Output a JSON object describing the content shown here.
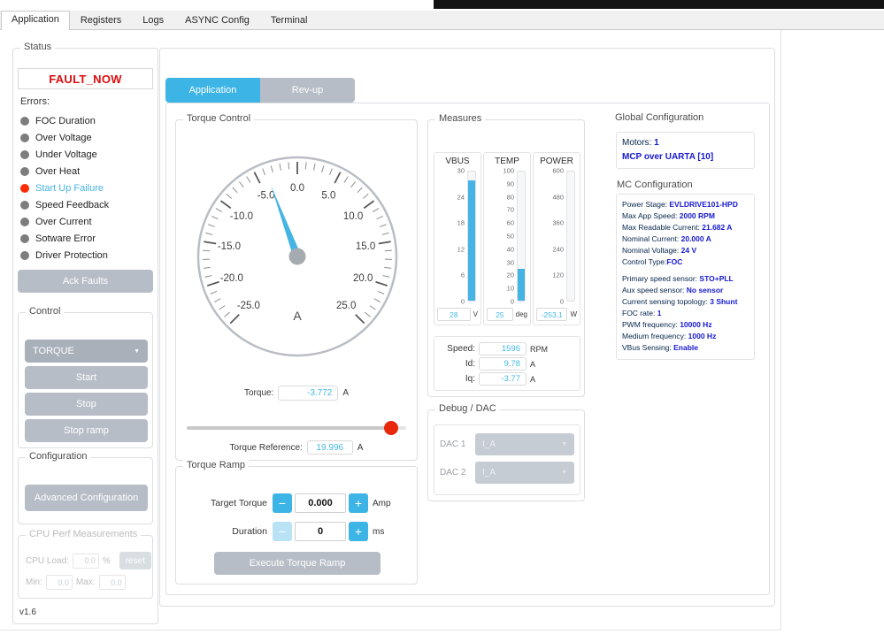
{
  "icons": {
    "chevron_down": "▼",
    "minus": "−",
    "plus": "+"
  },
  "window": {
    "tabs": [
      {
        "label": "Application",
        "active": true
      },
      {
        "label": "Registers"
      },
      {
        "label": "Logs"
      },
      {
        "label": "ASYNC Config"
      },
      {
        "label": "Terminal"
      }
    ]
  },
  "status": {
    "legend": "Status",
    "fault_banner": "FAULT_NOW",
    "errors_label": "Errors:",
    "errors": [
      {
        "label": "FOC Duration",
        "active": false
      },
      {
        "label": "Over Voltage",
        "active": false
      },
      {
        "label": "Under Voltage",
        "active": false
      },
      {
        "label": "Over Heat",
        "active": false
      },
      {
        "label": "Start Up Failure",
        "active": true
      },
      {
        "label": "Speed Feedback",
        "active": false
      },
      {
        "label": "Over Current",
        "active": false
      },
      {
        "label": "Sotware Error",
        "active": false
      },
      {
        "label": "Driver Protection",
        "active": false
      }
    ],
    "ack_button": "Ack Faults"
  },
  "control": {
    "legend": "Control",
    "mode_dropdown": "TORQUE",
    "start_button": "Start",
    "stop_button": "Stop",
    "stop_ramp_button": "Stop ramp"
  },
  "configuration": {
    "legend": "Configuration",
    "advanced_button": "Advanced Configuration"
  },
  "cpu_perf": {
    "legend": "CPU Perf Measurements",
    "load_label": "CPU Load:",
    "load_value": "0.0",
    "load_unit": "%",
    "reset_button": "reset",
    "min_label": "Min:",
    "min_value": "0.0",
    "max_label": "Max:",
    "max_value": "0.0"
  },
  "version": "v1.6",
  "main_tabs": {
    "application": "Application",
    "revup": "Rev-up"
  },
  "torque_control": {
    "legend": "Torque Control",
    "torque_label": "Torque:",
    "torque_value": "-3.772",
    "torque_unit": "A",
    "reference_label": "Torque Reference:",
    "reference_value": "19.996",
    "reference_unit": "A",
    "slider_fraction": 0.93
  },
  "torque_gauge": {
    "type": "gauge",
    "min": -25,
    "max": 25,
    "major_step": 5,
    "minor_step": 1,
    "start_angle": -135,
    "end_angle": 135,
    "unit": "A",
    "value": -3.772
  },
  "torque_ramp": {
    "legend": "Torque Ramp",
    "target_label": "Target Torque",
    "target_value": "0.000",
    "target_unit": "Amp",
    "duration_label": "Duration",
    "duration_value": "0",
    "duration_unit": "ms",
    "execute_button": "Execute Torque Ramp"
  },
  "measures": {
    "legend": "Measures",
    "gauges": [
      {
        "name": "VBUS",
        "min": 0,
        "max": 30,
        "ticks": [
          30,
          24,
          18,
          12,
          6,
          0
        ],
        "value": 28,
        "display": "28",
        "unit": "V"
      },
      {
        "name": "TEMP",
        "min": 0,
        "max": 100,
        "ticks": [
          100,
          90,
          80,
          70,
          60,
          50,
          40,
          30,
          20,
          10,
          0
        ],
        "value": 25,
        "display": "25",
        "unit": "deg"
      },
      {
        "name": "POWER",
        "min": 0,
        "max": 600,
        "ticks": [
          600,
          480,
          360,
          240,
          120,
          0
        ],
        "value": -253.1,
        "display": "-253.1",
        "unit": "W"
      }
    ],
    "speed_label": "Speed:",
    "speed_value": "1596",
    "speed_unit": "RPM",
    "id_label": "Id:",
    "id_value": "9.78",
    "id_unit": "A",
    "iq_label": "Iq:",
    "iq_value": "-3.77",
    "iq_unit": "A"
  },
  "debug_dac": {
    "legend": "Debug / DAC",
    "dac1_label": "DAC 1",
    "dac1_value": "I_A",
    "dac2_label": "DAC 2",
    "dac2_value": "I_A"
  },
  "global_config": {
    "legend": "Global Configuration",
    "motors_label": "Motors: ",
    "motors_value": "1",
    "mcp_line": "MCP over UARTA [10]",
    "mc_legend": "MC Configuration",
    "mc_items": [
      {
        "label": "Power Stage: ",
        "value": "EVLDRIVE101-HPD"
      },
      {
        "label": "Max App Speed: ",
        "value": "2000 RPM"
      },
      {
        "label": "Max Readable Current: ",
        "value": "21.682 A"
      },
      {
        "label": "Nominal Current: ",
        "value": "20.000 A"
      },
      {
        "label": "Nominal Voltage: ",
        "value": "24 V"
      },
      {
        "label": "Control Type:",
        "value": "FOC"
      },
      {
        "label": "Primary speed sensor: ",
        "value": "STO+PLL",
        "gap_before": true
      },
      {
        "label": "Aux speed sensor: ",
        "value": "No sensor"
      },
      {
        "label": "Current sensing topology: ",
        "value": "3 Shunt"
      },
      {
        "label": "FOC rate: ",
        "value": "1"
      },
      {
        "label": "PWM frequency: ",
        "value": "10000 Hz"
      },
      {
        "label": "Medium frequency: ",
        "value": "1000 Hz"
      },
      {
        "label": "VBus Sensing: ",
        "value": "Enable"
      }
    ]
  }
}
